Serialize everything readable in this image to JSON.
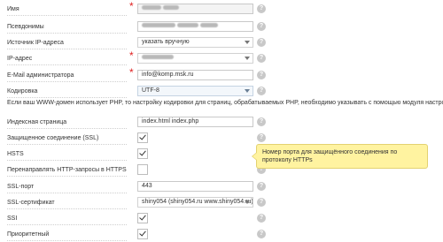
{
  "form": {
    "name": {
      "label": "Имя",
      "required": true
    },
    "aliases": {
      "label": "Псевдонимы"
    },
    "ip_source": {
      "label": "Источник IP-адреса",
      "value": "указать вручную"
    },
    "ip": {
      "label": "IP-адрес",
      "required": true
    },
    "admin_email": {
      "label": "E-Mail администратора",
      "required": true,
      "value": "info@komp.msk.ru"
    },
    "encoding": {
      "label": "Кодировка",
      "value": "UTF-8"
    },
    "php_note": "Если ваш WWW-домен использует PHP, то настройку кодировки для страниц, обрабатываемых PHP, необходимо указывать с помощью модуля настроек PHP",
    "index_page": {
      "label": "Индексная страница",
      "value": "index.html index.php"
    },
    "ssl_connection": {
      "label": "Защищенное соединение (SSL)",
      "checked": true
    },
    "hsts": {
      "label": "HSTS",
      "checked": true
    },
    "https_redirect": {
      "label": "Перенаправлять HTTP-запросы в HTTPS",
      "checked": false
    },
    "ssl_port": {
      "label": "SSL-порт",
      "value": "443"
    },
    "ssl_cert": {
      "label": "SSL-сертификат",
      "value": "shiny054 (shiny054.ru www.shiny054.ru)"
    },
    "ssi": {
      "label": "SSI",
      "checked": true
    },
    "priority": {
      "label": "Приоритетный",
      "checked": true
    }
  },
  "tooltip": "Номер порта для защищённого соединения по протоколу HTTPs",
  "help_glyph": "?",
  "required_glyph": "*",
  "colors": {
    "required": "#e02020",
    "tooltip_bg": "#fff3a0",
    "help_bg": "#c8c8c8"
  }
}
